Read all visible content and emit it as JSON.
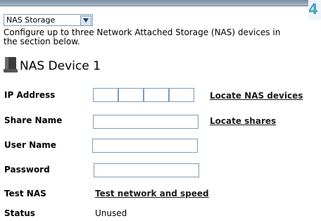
{
  "corner": {
    "number": "4"
  },
  "storage_select": {
    "value": "NAS Storage",
    "arrow": "chevron-down-icon"
  },
  "intro": "Configure up to three Network Attached Storage (NAS) devices in the section below.",
  "device": {
    "title": "NAS Device 1",
    "icon": "nas-device-icon"
  },
  "labels": {
    "ip": "IP Address",
    "share": "Share Name",
    "user": "User Name",
    "password": "Password",
    "test": "Test NAS",
    "status": "Status"
  },
  "links": {
    "locate_nas": "Locate NAS devices",
    "locate_shares": "Locate shares",
    "test_network": "Test network and speed"
  },
  "fields": {
    "ip": [
      "",
      "",
      "",
      ""
    ],
    "share": "",
    "user": "",
    "password": ""
  },
  "status_value": "Unused"
}
